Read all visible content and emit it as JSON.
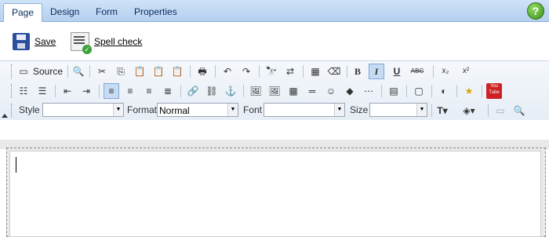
{
  "tabs": [
    {
      "label": "Page",
      "active": true
    },
    {
      "label": "Design",
      "active": false
    },
    {
      "label": "Form",
      "active": false
    },
    {
      "label": "Properties",
      "active": false
    }
  ],
  "help": {
    "label": "?"
  },
  "actions": {
    "save_label": "Save",
    "spell_label": "Spell check"
  },
  "toolbar": {
    "source_label": "Source",
    "bold": "B",
    "italic": "I",
    "underline": "U",
    "strike": "ABC",
    "subscript": "x₂",
    "superscript": "x²",
    "youtube": "You Tube"
  },
  "combos": {
    "style_label": "Style",
    "style_value": "",
    "format_label": "Format",
    "format_value": "Normal",
    "font_label": "Font",
    "font_value": "",
    "size_label": "Size",
    "size_value": ""
  },
  "icons": {
    "accent": "#2b4f9e",
    "tab_bar": "#b6d0ef"
  }
}
